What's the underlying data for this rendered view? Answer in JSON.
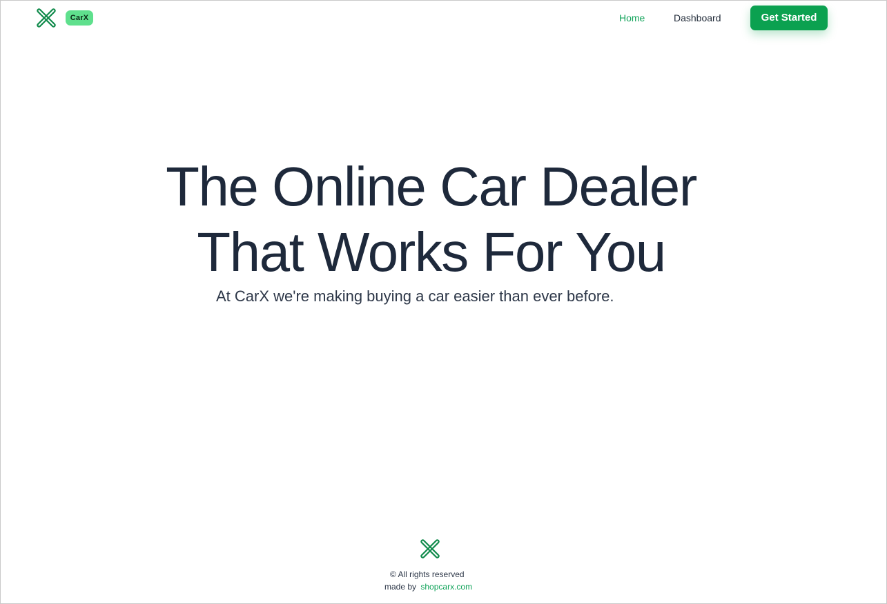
{
  "brand": {
    "name": "CarX",
    "logo_icon": "crossed-wrench-x-icon",
    "accent_color": "#0ba150",
    "badge_color": "#5fe08d"
  },
  "nav": {
    "home": "Home",
    "dashboard": "Dashboard",
    "cta": "Get Started"
  },
  "hero": {
    "line1": "The Online Car Dealer",
    "line2": "That Works For You",
    "subtitle": "At CarX we're making buying a car easier than ever before."
  },
  "footer": {
    "logo_icon": "crossed-wrench-x-icon",
    "copyright": "© All rights reserved",
    "made_by": "made by",
    "link_text": "shopcarx.com"
  }
}
